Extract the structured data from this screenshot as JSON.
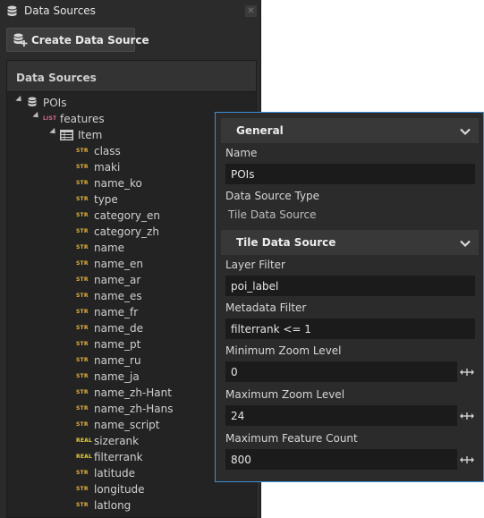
{
  "window": {
    "title": "Data Sources",
    "close_glyph": "✕"
  },
  "toolbar": {
    "create_label": "Create Data Source"
  },
  "data_sources_panel": {
    "header": "Data Sources"
  },
  "tree": {
    "root": {
      "label": "POIs",
      "icon": "database-icon"
    },
    "list": {
      "label": "features",
      "tag": "LIST"
    },
    "item": {
      "label": "Item",
      "icon": "table-icon"
    },
    "fields": [
      {
        "tag": "STR",
        "label": "class"
      },
      {
        "tag": "STR",
        "label": "maki"
      },
      {
        "tag": "STR",
        "label": "name_ko"
      },
      {
        "tag": "STR",
        "label": "type"
      },
      {
        "tag": "STR",
        "label": "category_en"
      },
      {
        "tag": "STR",
        "label": "category_zh"
      },
      {
        "tag": "STR",
        "label": "name"
      },
      {
        "tag": "STR",
        "label": "name_en"
      },
      {
        "tag": "STR",
        "label": "name_ar"
      },
      {
        "tag": "STR",
        "label": "name_es"
      },
      {
        "tag": "STR",
        "label": "name_fr"
      },
      {
        "tag": "STR",
        "label": "name_de"
      },
      {
        "tag": "STR",
        "label": "name_pt"
      },
      {
        "tag": "STR",
        "label": "name_ru"
      },
      {
        "tag": "STR",
        "label": "name_ja"
      },
      {
        "tag": "STR",
        "label": "name_zh-Hant"
      },
      {
        "tag": "STR",
        "label": "name_zh-Hans"
      },
      {
        "tag": "STR",
        "label": "name_script"
      },
      {
        "tag": "REAL",
        "label": "sizerank"
      },
      {
        "tag": "REAL",
        "label": "filterrank"
      },
      {
        "tag": "STR",
        "label": "latitude"
      },
      {
        "tag": "STR",
        "label": "longitude"
      },
      {
        "tag": "STR",
        "label": "latlong"
      }
    ]
  },
  "inspector": {
    "general": {
      "header": "General",
      "name_label": "Name",
      "name_value": "POIs",
      "type_label": "Data Source Type",
      "type_value": "Tile Data Source"
    },
    "tile": {
      "header": "Tile Data Source",
      "layer_filter_label": "Layer Filter",
      "layer_filter_value": "poi_label",
      "metadata_filter_label": "Metadata Filter",
      "metadata_filter_value": "filterrank <= 1",
      "min_zoom_label": "Minimum Zoom Level",
      "min_zoom_value": "0",
      "max_zoom_label": "Maximum Zoom Level",
      "max_zoom_value": "24",
      "max_feature_label": "Maximum Feature Count",
      "max_feature_value": "800"
    }
  },
  "colors": {
    "panel_bg": "#2b2b2b",
    "accent_border": "#3f8fd6",
    "str_tag": "#e3b23c",
    "real_tag": "#e3cf3c",
    "list_tag": "#d66a8c"
  }
}
